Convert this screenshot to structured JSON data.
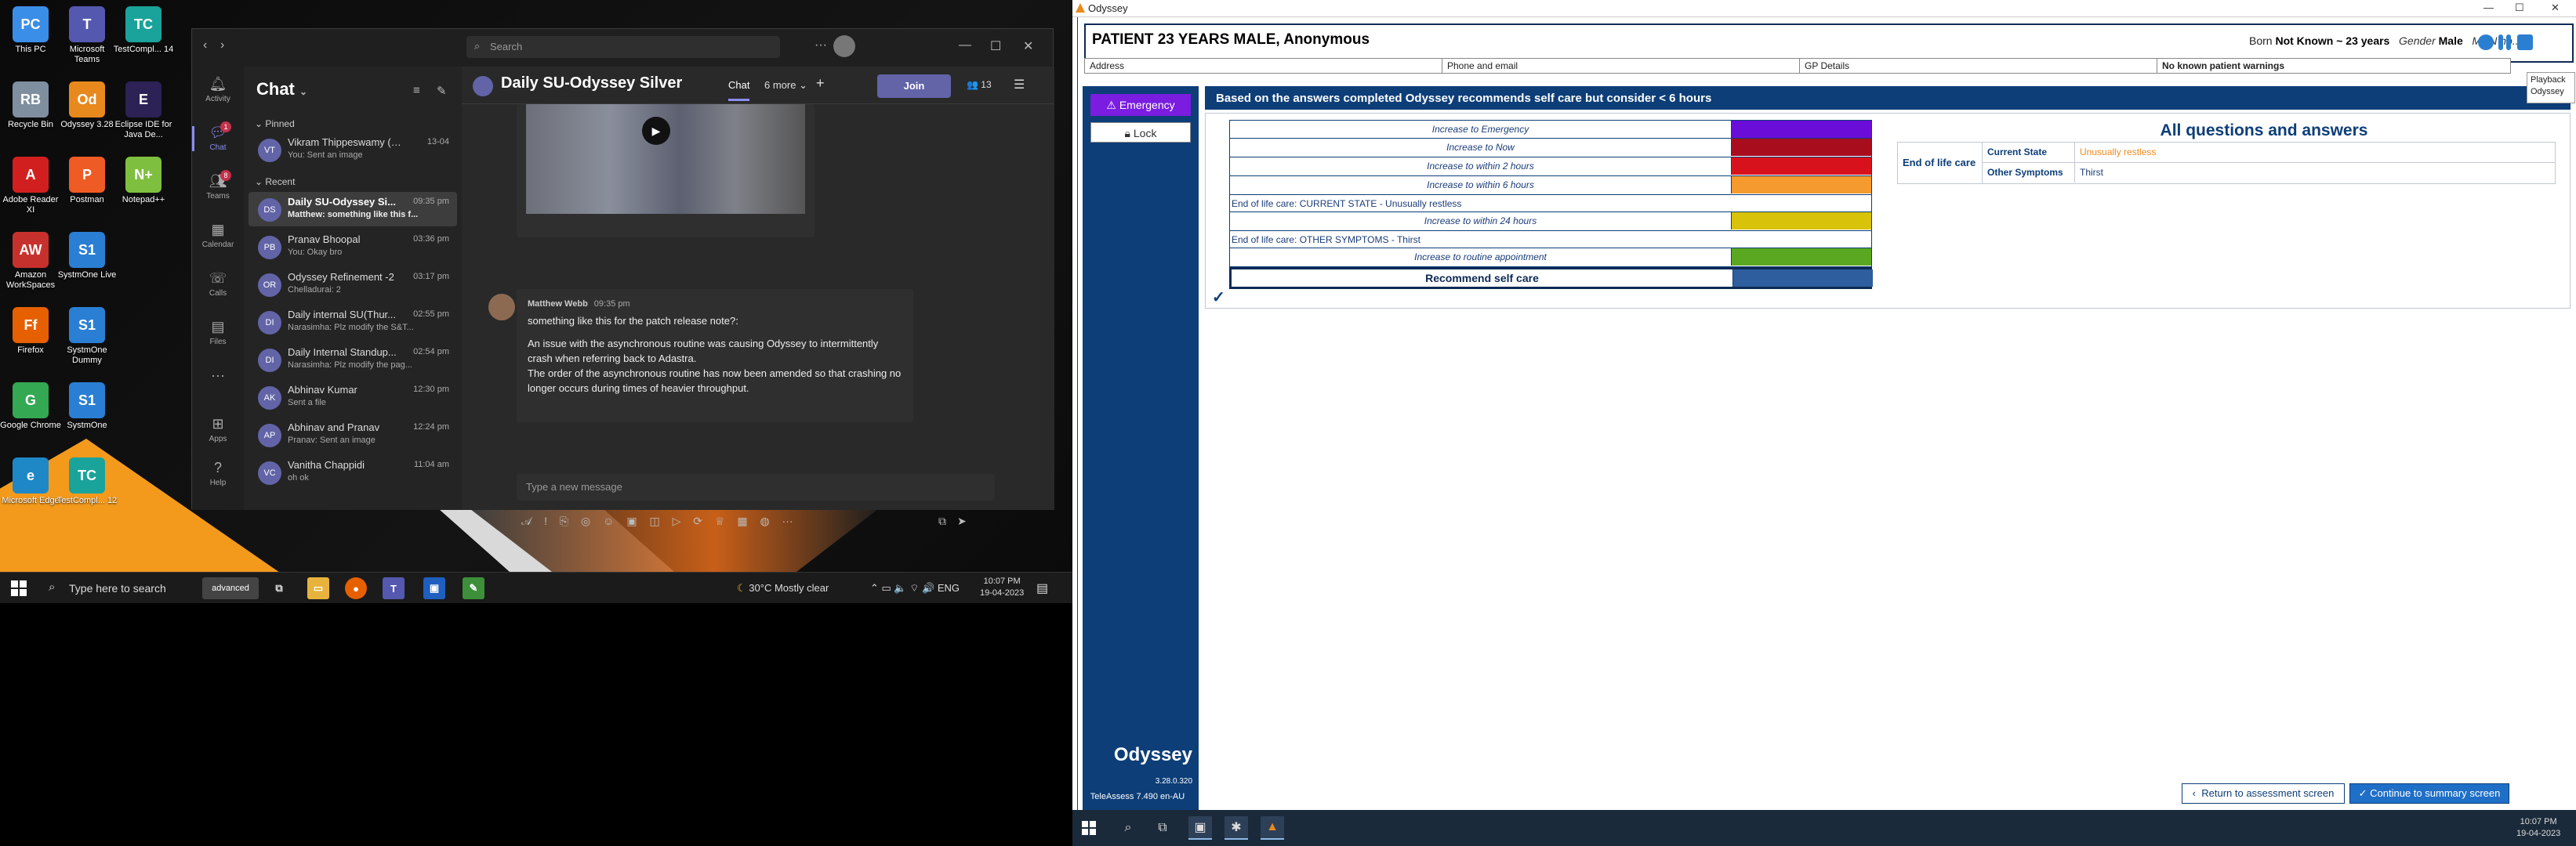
{
  "desktop": {
    "icons": [
      {
        "label": "This PC",
        "color": "#3b8ee8",
        "glyph": "PC"
      },
      {
        "label": "Microsoft Teams",
        "color": "#5558af",
        "glyph": "T"
      },
      {
        "label": "TestCompl... 14",
        "color": "#1aa39a",
        "glyph": "TC"
      },
      {
        "label": "Recycle Bin",
        "color": "#7f8fa0",
        "glyph": "RB"
      },
      {
        "label": "Odyssey 3.28",
        "color": "#e8891d",
        "glyph": "Od"
      },
      {
        "label": "Eclipse IDE for Java De...",
        "color": "#2c2255",
        "glyph": "E"
      },
      {
        "label": "Adobe Reader XI",
        "color": "#d11f1f",
        "glyph": "A"
      },
      {
        "label": "Postman",
        "color": "#ef5b25",
        "glyph": "P"
      },
      {
        "label": "Notepad++",
        "color": "#7fbf3f",
        "glyph": "N+"
      },
      {
        "label": "Amazon WorkSpaces",
        "color": "#c7312d",
        "glyph": "AW"
      },
      {
        "label": "SystmOne Live",
        "color": "#2a7fd4",
        "glyph": "S1"
      },
      {
        "label": "Firefox",
        "color": "#e66000",
        "glyph": "Ff"
      },
      {
        "label": "SystmOne Dummy",
        "color": "#2a7fd4",
        "glyph": "S1"
      },
      {
        "label": "Google Chrome",
        "color": "#34a853",
        "glyph": "G"
      },
      {
        "label": "SystmOne",
        "color": "#2a7fd4",
        "glyph": "S1"
      },
      {
        "label": "Microsoft Edge",
        "color": "#1e88c7",
        "glyph": "e"
      },
      {
        "label": "TestCompl... 12",
        "color": "#1aa39a",
        "glyph": "TC"
      }
    ]
  },
  "teams": {
    "search_placeholder": "Search",
    "rail": [
      {
        "label": "Activity",
        "icon": "bell"
      },
      {
        "label": "Chat",
        "icon": "chat",
        "badge": "1"
      },
      {
        "label": "Teams",
        "icon": "teams",
        "badge": "8"
      },
      {
        "label": "Calendar",
        "icon": "calendar"
      },
      {
        "label": "Calls",
        "icon": "phone"
      },
      {
        "label": "Files",
        "icon": "file"
      },
      {
        "label": "...",
        "icon": "more"
      },
      {
        "label": "Apps",
        "icon": "apps"
      },
      {
        "label": "Help",
        "icon": "help"
      }
    ],
    "chat_title": "Chat",
    "pinned_label": "Pinned",
    "recent_label": "Recent",
    "pinned": [
      {
        "name": "Vikram Thippeswamy (Yo...",
        "preview": "You: Sent an image",
        "time": "13-04",
        "initials": "VT"
      }
    ],
    "recent": [
      {
        "name": "Daily SU-Odyssey Si...",
        "preview": "Matthew: something like this f...",
        "time": "09:35 pm",
        "initials": "DS"
      },
      {
        "name": "Pranav Bhoopal",
        "preview": "You: Okay bro",
        "time": "03:36 pm",
        "initials": "PB"
      },
      {
        "name": "Odyssey Refinement -2",
        "preview": "Chelladurai: 2",
        "time": "03:17 pm",
        "initials": "OR"
      },
      {
        "name": "Daily internal SU(Thur...",
        "preview": "Narasimha: Plz modify the S&T...",
        "time": "02:55 pm",
        "initials": "DI"
      },
      {
        "name": "Daily Internal Standup...",
        "preview": "Narasimha: Plz modify the pag...",
        "time": "02:54 pm",
        "initials": "DI"
      },
      {
        "name": "Abhinav Kumar",
        "preview": "Sent a file",
        "time": "12:30 pm",
        "initials": "AK"
      },
      {
        "name": "Abhinav and Pranav",
        "preview": "Pranav: Sent an image",
        "time": "12:24 pm",
        "initials": "AP"
      },
      {
        "name": "Vanitha Chappidi",
        "preview": "oh ok",
        "time": "11:04 am",
        "initials": "VC"
      }
    ],
    "header": {
      "title": "Daily SU-Odyssey Silver",
      "tab_chat": "Chat",
      "tab_more": "6 more",
      "join": "Join",
      "people": "13"
    },
    "message": {
      "sender": "Matthew Webb",
      "time": "09:35 pm",
      "line1": "something like this for the patch release note?:",
      "line2": "An issue with the asynchronous routine was causing Odyssey to intermittently crash when referring back to Adastra.",
      "line3": "The order of the asynchronous routine has now been amended so that crashing no longer occurs during times of heavier throughput."
    },
    "compose_placeholder": "Type a new message"
  },
  "taskbar_left": {
    "search": "Type here to search",
    "advanced": "advanced",
    "weather": "30°C  Mostly clear",
    "lang": "ENG",
    "time": "10:07 PM",
    "date": "19-04-2023"
  },
  "odyssey": {
    "window_title": "Odyssey",
    "patient_name": "PATIENT 23 YEARS MALE, Anonymous",
    "born_label": "Born",
    "born_value": "Not Known ~ 23 years",
    "gender_label": "Gender",
    "gender_value": "Male",
    "mrn_label": "MRN no...",
    "playback_tip_1": "Playback",
    "playback_tip_2": "Odyssey",
    "info_row": {
      "address": "Address",
      "phone": "Phone and email",
      "gp": "GP Details",
      "warnings": "No known patient warnings"
    },
    "emergency_btn": "Emergency",
    "lock_btn": "Lock",
    "brand_name": "Odyssey",
    "brand_version": "3.28.0.320",
    "brand_tele": "TeleAssess 7.490 en-AU",
    "banner": "Based on the answers completed Odyssey recommends self care but consider < 6 hours",
    "recommendations": [
      {
        "label": "Increase to Emergency",
        "color": "#6a0dd8",
        "kind": "option"
      },
      {
        "label": "Increase to Now",
        "color": "#a80d1e",
        "kind": "option"
      },
      {
        "label": "Increase to within 2 hours",
        "color": "#d8121c",
        "kind": "option"
      },
      {
        "label": "Increase to within 6 hours",
        "color": "#f59a2e",
        "kind": "option"
      },
      {
        "label": "End of life care: CURRENT STATE - Unusually restless",
        "color": "",
        "kind": "section"
      },
      {
        "label": "Increase to within 24 hours",
        "color": "#d8c20a",
        "kind": "option"
      },
      {
        "label": "End of life care: OTHER SYMPTOMS - Thirst",
        "color": "",
        "kind": "section"
      },
      {
        "label": "Increase to routine appointment",
        "color": "#5aa821",
        "kind": "option"
      },
      {
        "label": "Recommend self care",
        "color": "#2e5e9e",
        "kind": "selected"
      }
    ],
    "check_mark": "✓",
    "aqa_title": "All questions and answers",
    "aqa_category": "End of life care",
    "aqa": [
      {
        "question": "Current State",
        "answer": "Unusually restless",
        "answer_color": "#f08a1c"
      },
      {
        "question": "Other Symptoms",
        "answer": "Thirst",
        "answer_color": "#1a3c7a"
      }
    ],
    "return_btn": "Return to assessment screen",
    "continue_btn": "Continue to summary screen",
    "taskbar_time": "10:07 PM",
    "taskbar_date": "19-04-2023"
  }
}
